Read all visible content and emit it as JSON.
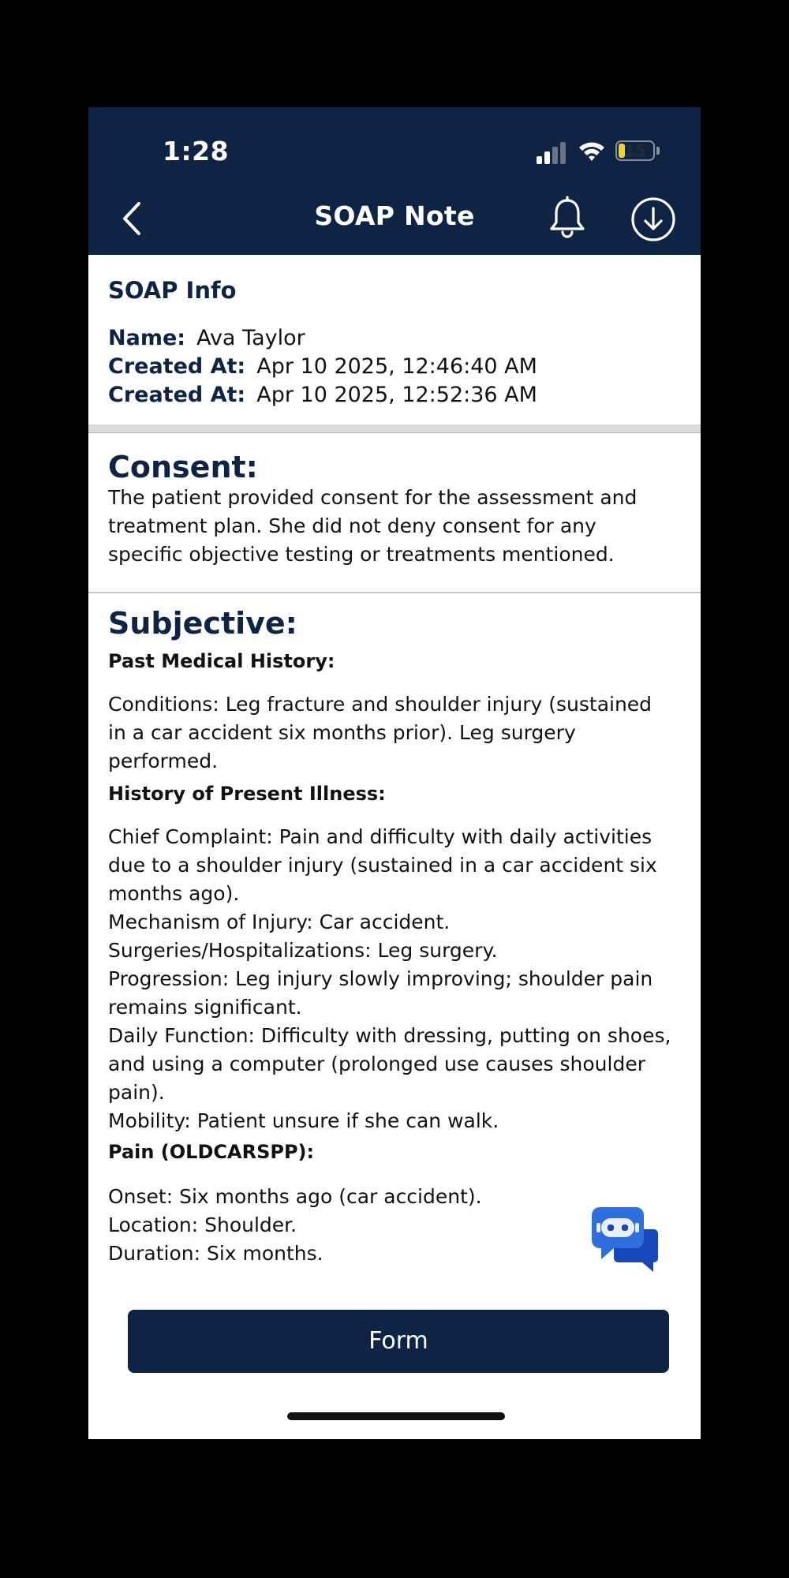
{
  "status_bar": {
    "time": "1:28",
    "battery": "15"
  },
  "header": {
    "title": "SOAP Note"
  },
  "info": {
    "heading": "SOAP Info",
    "name_label": "Name:",
    "name_value": "Ava Taylor",
    "created_label_1": "Created At:",
    "created_value_1": "Apr 10 2025, 12:46:40 AM",
    "created_label_2": "Created At:",
    "created_value_2": "Apr 10 2025, 12:52:36 AM"
  },
  "consent": {
    "heading": "Consent:",
    "lines": [
      "The patient provided consent for the assessment and",
      "treatment plan. She did not deny consent for any",
      "specific objective testing or treatments mentioned."
    ]
  },
  "subjective": {
    "heading": "Subjective:",
    "pmh_heading": "Past Medical History:",
    "pmh_lines": [
      "Conditions: Leg fracture and shoulder injury (sustained",
      "in a car accident six months prior). Leg surgery",
      "performed."
    ],
    "hpi_heading": "History of Present Illness:",
    "hpi_lines": [
      "Chief Complaint: Pain and difficulty with daily activities",
      "due to a shoulder injury (sustained in a car accident six",
      "months ago).",
      "Mechanism of Injury: Car accident.",
      "Surgeries/Hospitalizations: Leg surgery.",
      "Progression: Leg injury slowly improving; shoulder pain",
      "remains significant.",
      "Daily Function: Difficulty with dressing, putting on shoes,",
      "and using a computer (prolonged use causes shoulder",
      "pain).",
      "Mobility: Patient unsure if she can walk."
    ],
    "pain_heading": "Pain (OLDCARSPP):",
    "pain_lines": [
      "Onset: Six months ago (car accident).",
      "Location: Shoulder.",
      "Duration: Six months."
    ]
  },
  "form_button": {
    "label": "Form"
  },
  "colors": {
    "navy": "#0e2444",
    "bot_blue": "#1e56c8",
    "battery": "#f2d037"
  }
}
